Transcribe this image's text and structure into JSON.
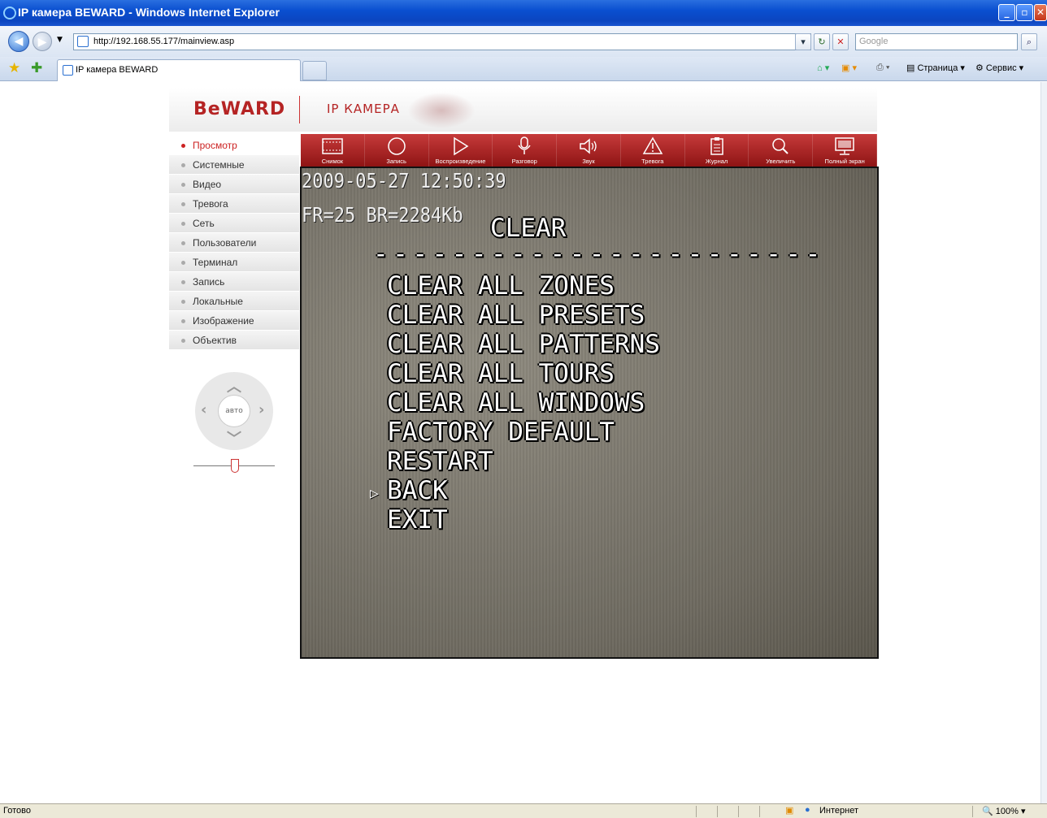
{
  "window": {
    "title": "IP камера BEWARD - Windows Internet Explorer"
  },
  "address_bar": {
    "url": "http://192.168.55.177/mainview.asp",
    "search_placeholder": "Google"
  },
  "tabs": {
    "active_label": "IP камера BEWARD"
  },
  "command_bar": {
    "page_label": "Страница",
    "tools_label": "Сервис"
  },
  "header": {
    "logo": "BeWARD",
    "title": "IP КАМЕРА"
  },
  "sidebar": {
    "items": [
      {
        "label": "Просмотр",
        "active": true
      },
      {
        "label": "Системные"
      },
      {
        "label": "Видео"
      },
      {
        "label": "Тревога"
      },
      {
        "label": "Сеть"
      },
      {
        "label": "Пользователи"
      },
      {
        "label": "Терминал"
      },
      {
        "label": "Запись"
      },
      {
        "label": "Локальные"
      },
      {
        "label": "Изображение"
      },
      {
        "label": "Объектив"
      }
    ]
  },
  "ptz": {
    "center_label": "авто",
    "up_icon": "chevron-up-icon",
    "down_icon": "chevron-down-icon",
    "left_icon": "chevron-left-icon",
    "right_icon": "chevron-right-icon"
  },
  "toolbar": {
    "buttons": [
      {
        "label": "Снимок",
        "icon": "film-icon"
      },
      {
        "label": "Запись",
        "icon": "record-icon"
      },
      {
        "label": "Воспроизведение",
        "icon": "play-icon"
      },
      {
        "label": "Разговор",
        "icon": "microphone-icon"
      },
      {
        "label": "Звук",
        "icon": "speaker-icon"
      },
      {
        "label": "Тревога",
        "icon": "alarm-icon"
      },
      {
        "label": "Журнал",
        "icon": "clipboard-icon"
      },
      {
        "label": "Увеличить",
        "icon": "magnifier-icon"
      },
      {
        "label": "Полный экран",
        "icon": "monitor-icon"
      }
    ]
  },
  "video": {
    "timestamp": "2009-05-27 12:50:39",
    "stats": "FR=25 BR=2284Kb",
    "menu_title": "CLEAR",
    "separator": "-----------------------",
    "menu_items": [
      "CLEAR ALL ZONES",
      "CLEAR ALL PRESETS",
      "CLEAR ALL PATTERNS",
      "CLEAR ALL TOURS",
      "CLEAR ALL WINDOWS",
      "FACTORY DEFAULT",
      "RESTART",
      "BACK",
      "EXIT"
    ],
    "selected_item": "BACK"
  },
  "status_bar": {
    "left_text": "Готово",
    "zone": "Интернет",
    "zoom": "100%"
  },
  "colors": {
    "brand_red": "#b52424",
    "toolbar_red": "#a82020",
    "ie_blue": "#0a4fd0"
  }
}
